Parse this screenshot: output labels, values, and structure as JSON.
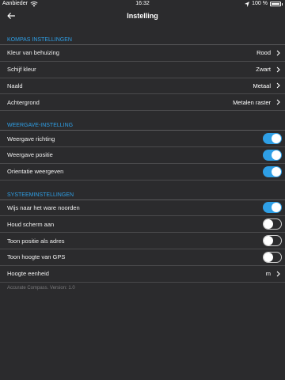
{
  "status": {
    "carrier": "Aanbieder",
    "time": "16:32",
    "battery": "100 %"
  },
  "nav": {
    "title": "Instelling"
  },
  "kompas": {
    "header": "KOMPAS INSTELLINGEN",
    "rows": [
      {
        "label": "Kleur van behuizing",
        "value": "Rood"
      },
      {
        "label": "Schijf kleur",
        "value": "Zwart"
      },
      {
        "label": "Naald",
        "value": "Metaal"
      },
      {
        "label": "Achtergrond",
        "value": "Metalen raster"
      }
    ]
  },
  "weergave": {
    "header": "WEERGAVE-INSTELLING",
    "rows": [
      {
        "label": "Weergave richting",
        "on": true
      },
      {
        "label": "Weergave positie",
        "on": true
      },
      {
        "label": "Orientatie weergeven",
        "on": true
      }
    ]
  },
  "systeem": {
    "header": "SYSTEEMINSTELLINGEN",
    "rows": [
      {
        "label": "Wijs naar het ware noorden",
        "on": true
      },
      {
        "label": "Houd scherm aan",
        "on": false
      },
      {
        "label": "Toon positie als adres",
        "on": false
      },
      {
        "label": "Toon hoogte van GPS",
        "on": false
      }
    ],
    "unit_label": "Hoogte eenheid",
    "unit_value": "m"
  },
  "version": "Accurate Compass. Version: 1.0",
  "colors": {
    "accent": "#2e9fe6",
    "background": "#2b2b2d"
  }
}
